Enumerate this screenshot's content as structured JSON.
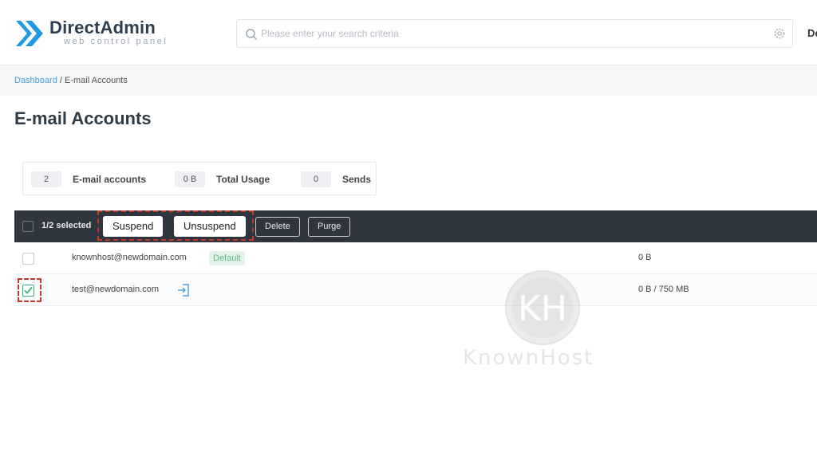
{
  "brand": {
    "name": "DirectAdmin",
    "tagline": "web control panel",
    "accent": "#1e9be0"
  },
  "header": {
    "search_placeholder": "Please enter your search criteria",
    "user_initials": "De"
  },
  "breadcrumb": {
    "root": "Dashboard",
    "separator": " / ",
    "current": "E-mail Accounts"
  },
  "page": {
    "title": "E-mail Accounts"
  },
  "stats": [
    {
      "value": "2",
      "label": "E-mail accounts"
    },
    {
      "value": "0 B",
      "label": "Total Usage"
    },
    {
      "value": "0",
      "label": "Sends"
    }
  ],
  "toolbar": {
    "selected": "1/2 selected",
    "suspend": "Suspend",
    "unsuspend": "Unsuspend",
    "delete": "Delete",
    "purge": "Purge"
  },
  "accounts": [
    {
      "email": "knownhost@newdomain.com",
      "badge": "Default",
      "usage": "0 B",
      "checked": false
    },
    {
      "email": "test@newdomain.com",
      "usage": "0 B / 750 MB",
      "checked": true
    }
  ],
  "watermark": {
    "text": "KnownHost"
  },
  "colors": {
    "toolbar_bg": "#2f3640",
    "highlight": "#c0392b",
    "check_green": "#3ab37a",
    "link": "#4a9fd8"
  }
}
